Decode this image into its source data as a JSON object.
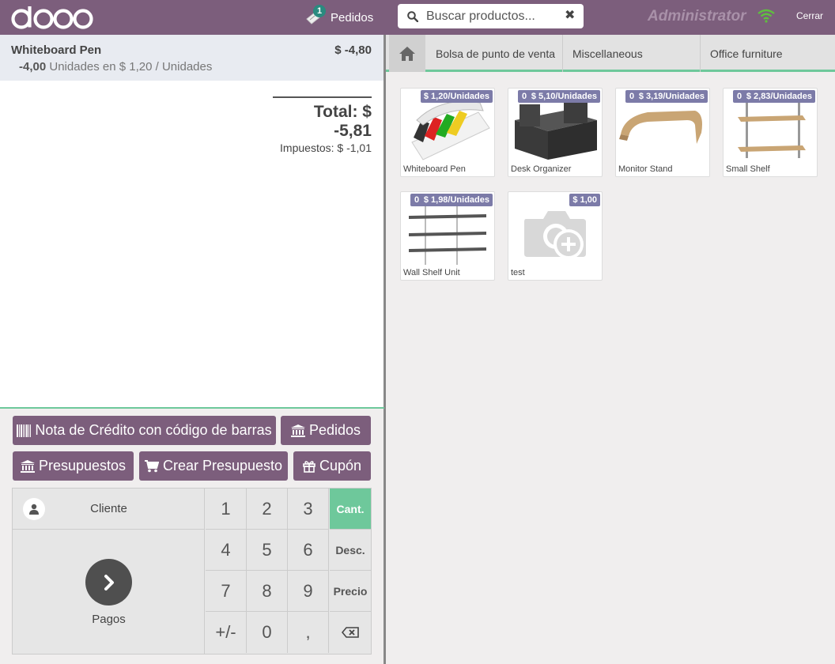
{
  "header": {
    "logo_text": "odoo",
    "orders_count": "1",
    "orders_label": "Pedidos",
    "search_placeholder": "Buscar productos...",
    "user_name": "Administrator",
    "close_label": "Cerrar"
  },
  "order": {
    "lines": [
      {
        "product": "Whiteboard Pen",
        "price": "$ -4,80",
        "qty": "-4,00",
        "unit_text": "Unidades en $ 1,20 / Unidades"
      }
    ],
    "total_label": "Total: $ -5,81",
    "tax_label": "Impuestos: $ -1,01"
  },
  "actions": {
    "credit_note": "Nota de Crédito con código de barras",
    "orders": "Pedidos",
    "quotations": "Presupuestos",
    "create_quotation": "Crear Presupuesto",
    "coupon": "Cupón"
  },
  "numpad": {
    "customer": "Cliente",
    "payment": "Pagos",
    "keys": [
      "1",
      "2",
      "3",
      "4",
      "5",
      "6",
      "7",
      "8",
      "9",
      "+/-",
      "0",
      ","
    ],
    "modes": [
      "Cant.",
      "Desc.",
      "Precio"
    ],
    "active_mode": "Cant."
  },
  "categories": [
    "Bolsa de punto de venta",
    "Miscellaneous",
    "Office furniture"
  ],
  "products": [
    {
      "name": "Whiteboard Pen",
      "price": "$ 1,20/Unidades",
      "qty": ""
    },
    {
      "name": "Desk Organizer",
      "price": "$ 5,10/Unidades",
      "qty": "0"
    },
    {
      "name": "Monitor Stand",
      "price": "$ 3,19/Unidades",
      "qty": "0"
    },
    {
      "name": "Small Shelf",
      "price": "$ 2,83/Unidades",
      "qty": "0"
    },
    {
      "name": "Wall Shelf Unit",
      "price": "$ 1,98/Unidades",
      "qty": "0"
    },
    {
      "name": "test",
      "price": "$ 1,00",
      "qty": ""
    }
  ],
  "colors": {
    "brand": "#7c5e7c",
    "accent_green": "#6ec89b",
    "badge": "#7c7ba8"
  }
}
